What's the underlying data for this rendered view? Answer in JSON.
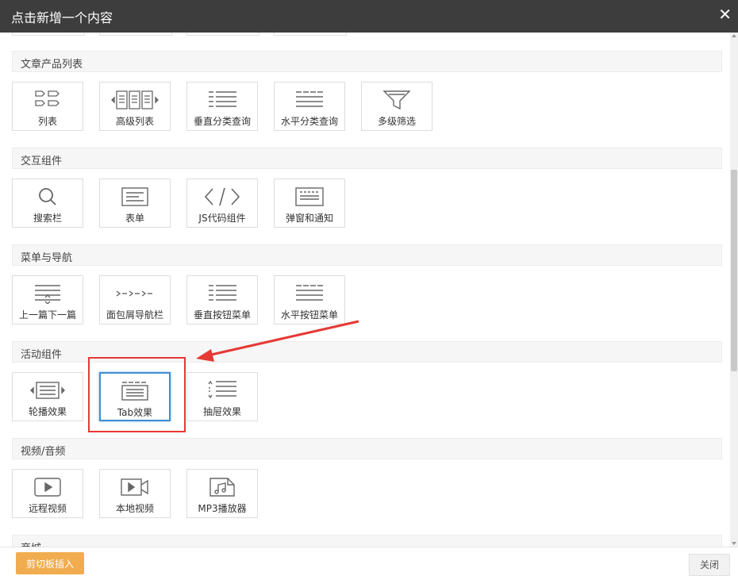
{
  "dialog": {
    "title": "点击新增一个内容",
    "close_icon": "close-icon"
  },
  "sections": [
    {
      "name": "文章产品列表",
      "items": [
        {
          "label": "列表",
          "icon": "list-icon"
        },
        {
          "label": "高级列表",
          "icon": "advanced-list-icon"
        },
        {
          "label": "垂直分类查询",
          "icon": "vertical-category-icon"
        },
        {
          "label": "水平分类查询",
          "icon": "horizontal-category-icon"
        },
        {
          "label": "多级筛选",
          "icon": "filter-icon"
        }
      ]
    },
    {
      "name": "交互组件",
      "items": [
        {
          "label": "搜索栏",
          "icon": "search-icon"
        },
        {
          "label": "表单",
          "icon": "form-icon"
        },
        {
          "label": "JS代码组件",
          "icon": "code-icon"
        },
        {
          "label": "弹窗和通知",
          "icon": "popup-icon"
        }
      ]
    },
    {
      "name": "菜单与导航",
      "items": [
        {
          "label": "上一篇下一篇",
          "icon": "prev-next-icon"
        },
        {
          "label": "面包屑导航栏",
          "icon": "breadcrumb-icon"
        },
        {
          "label": "垂直按钮菜单",
          "icon": "vertical-menu-icon"
        },
        {
          "label": "水平按钮菜单",
          "icon": "horizontal-menu-icon"
        }
      ]
    },
    {
      "name": "活动组件",
      "items": [
        {
          "label": "轮播效果",
          "icon": "carousel-icon"
        },
        {
          "label": "Tab效果",
          "icon": "tab-icon"
        },
        {
          "label": "抽屉效果",
          "icon": "drawer-icon"
        }
      ]
    },
    {
      "name": "视频/音频",
      "items": [
        {
          "label": "远程视频",
          "icon": "remote-video-icon"
        },
        {
          "label": "本地视频",
          "icon": "local-video-icon"
        },
        {
          "label": "MP3播放器",
          "icon": "mp3-icon"
        }
      ]
    },
    {
      "name": "商城"
    }
  ],
  "footer": {
    "paste_label": "剪切板插入",
    "close_label": "关闭"
  },
  "colors": {
    "titlebar": "#3d3d3d",
    "accent_orange": "#f0ac4e",
    "highlight_red": "#e53935",
    "selected_border": "#3e8ed0"
  }
}
